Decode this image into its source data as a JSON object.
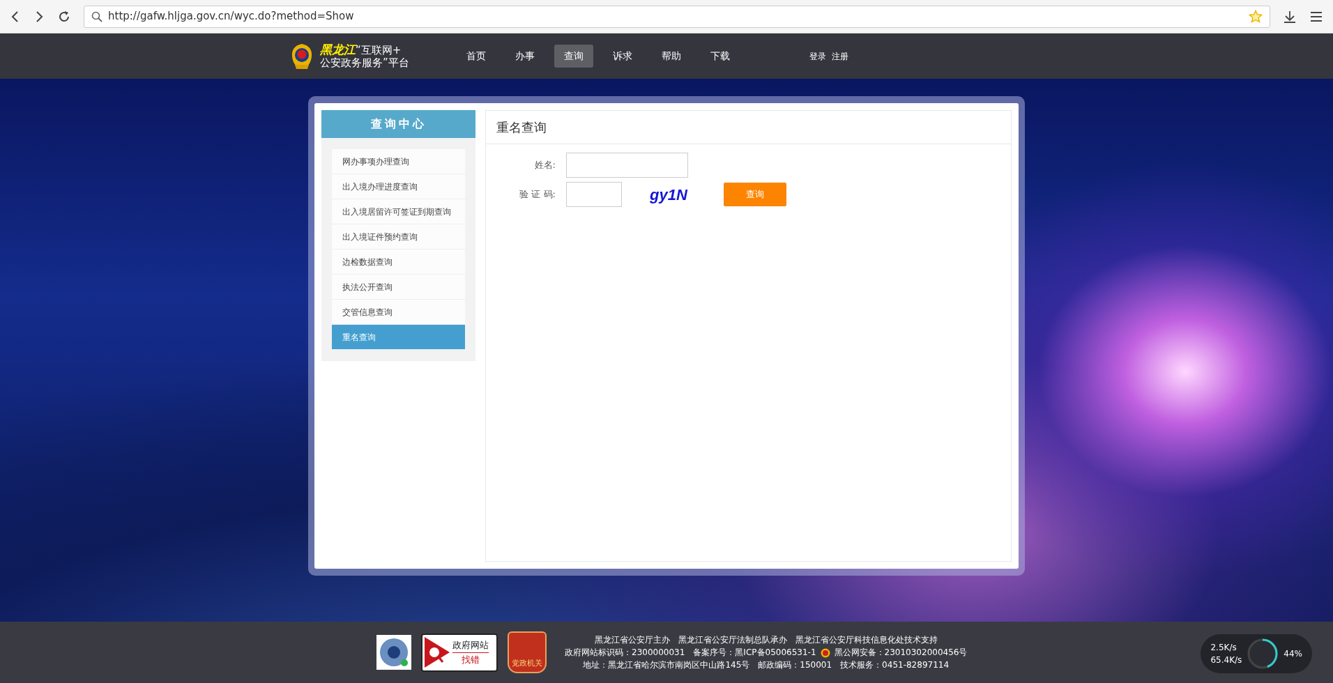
{
  "browser": {
    "url": "http://gafw.hljga.gov.cn/wyc.do?method=Show"
  },
  "header": {
    "logo_line_1": "黑龙江",
    "logo_line_1b": "“互联网+",
    "logo_line_2": "公安政务服务”平台",
    "nav": [
      {
        "label": "首页",
        "selected": false
      },
      {
        "label": "办事",
        "selected": false
      },
      {
        "label": "查询",
        "selected": true
      },
      {
        "label": "诉求",
        "selected": false
      },
      {
        "label": "帮助",
        "selected": false
      },
      {
        "label": "下载",
        "selected": false
      }
    ],
    "account": [
      "登录",
      "注册"
    ]
  },
  "sidebar": {
    "title": "查询中心",
    "items": [
      {
        "label": "网办事项办理查询",
        "selected": false
      },
      {
        "label": "出入境办理进度查询",
        "selected": false
      },
      {
        "label": "出入境居留许可签证到期查询",
        "selected": false
      },
      {
        "label": "出入境证件预约查询",
        "selected": false
      },
      {
        "label": "边检数据查询",
        "selected": false
      },
      {
        "label": "执法公开查询",
        "selected": false
      },
      {
        "label": "交管信息查询",
        "selected": false
      },
      {
        "label": "重名查询",
        "selected": true
      }
    ]
  },
  "form": {
    "title": "重名查询",
    "name_label": "姓名:",
    "captcha_label": "验 证 码:",
    "captcha_text": "gy1N",
    "submit": "查询"
  },
  "footer": {
    "badge_title": "政府网站",
    "badge_action": "找错",
    "party_badge": "党政机关",
    "lines": [
      [
        "黑龙江省公安厅主办",
        "黑龙江省公安厅法制总队承办",
        "黑龙江省公安厅科技信息化处技术支持"
      ],
      [
        "政府网站标识码：2300000031",
        "备案序号：黑ICP备05006531-1",
        "黑公网安备：23010302000456号"
      ],
      [
        "地址：黑龙江省哈尔滨市南岗区中山路145号",
        "邮政编码：150001",
        "技术服务：0451-82897114"
      ]
    ]
  },
  "speed_widget": {
    "upload": "2.5K/s",
    "download": "65.4K/s",
    "percent": "44%",
    "level": 0.44
  }
}
